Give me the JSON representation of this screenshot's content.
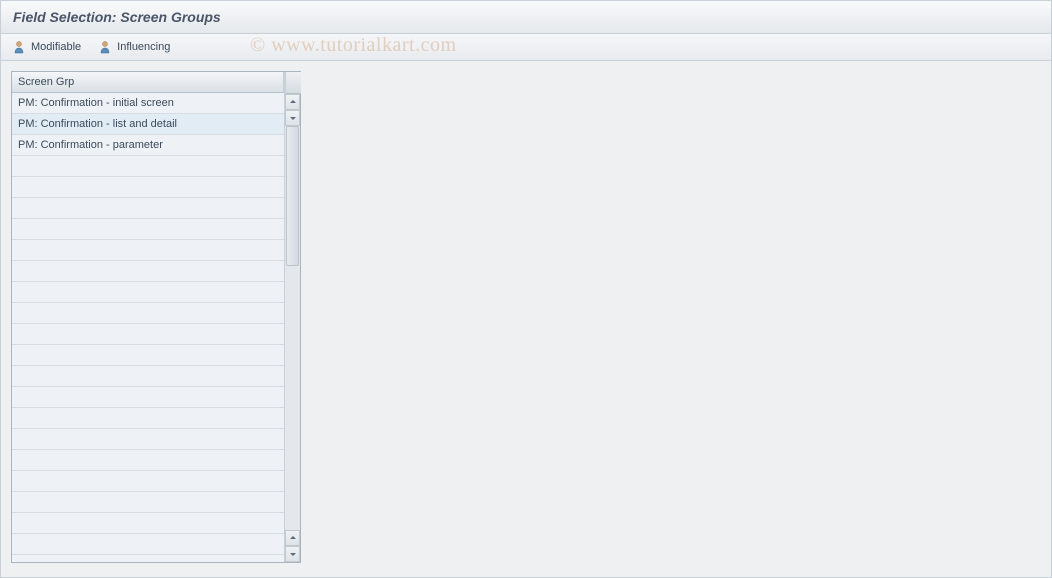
{
  "header": {
    "title": "Field Selection: Screen Groups"
  },
  "toolbar": {
    "modifiable_label": "Modifiable",
    "influencing_label": "Influencing"
  },
  "table": {
    "header": "Screen Grp",
    "rows": [
      "PM: Confirmation - initial screen",
      "PM: Confirmation - list and detail",
      "PM: Confirmation - parameter"
    ]
  },
  "watermark": "© www.tutorialkart.com"
}
